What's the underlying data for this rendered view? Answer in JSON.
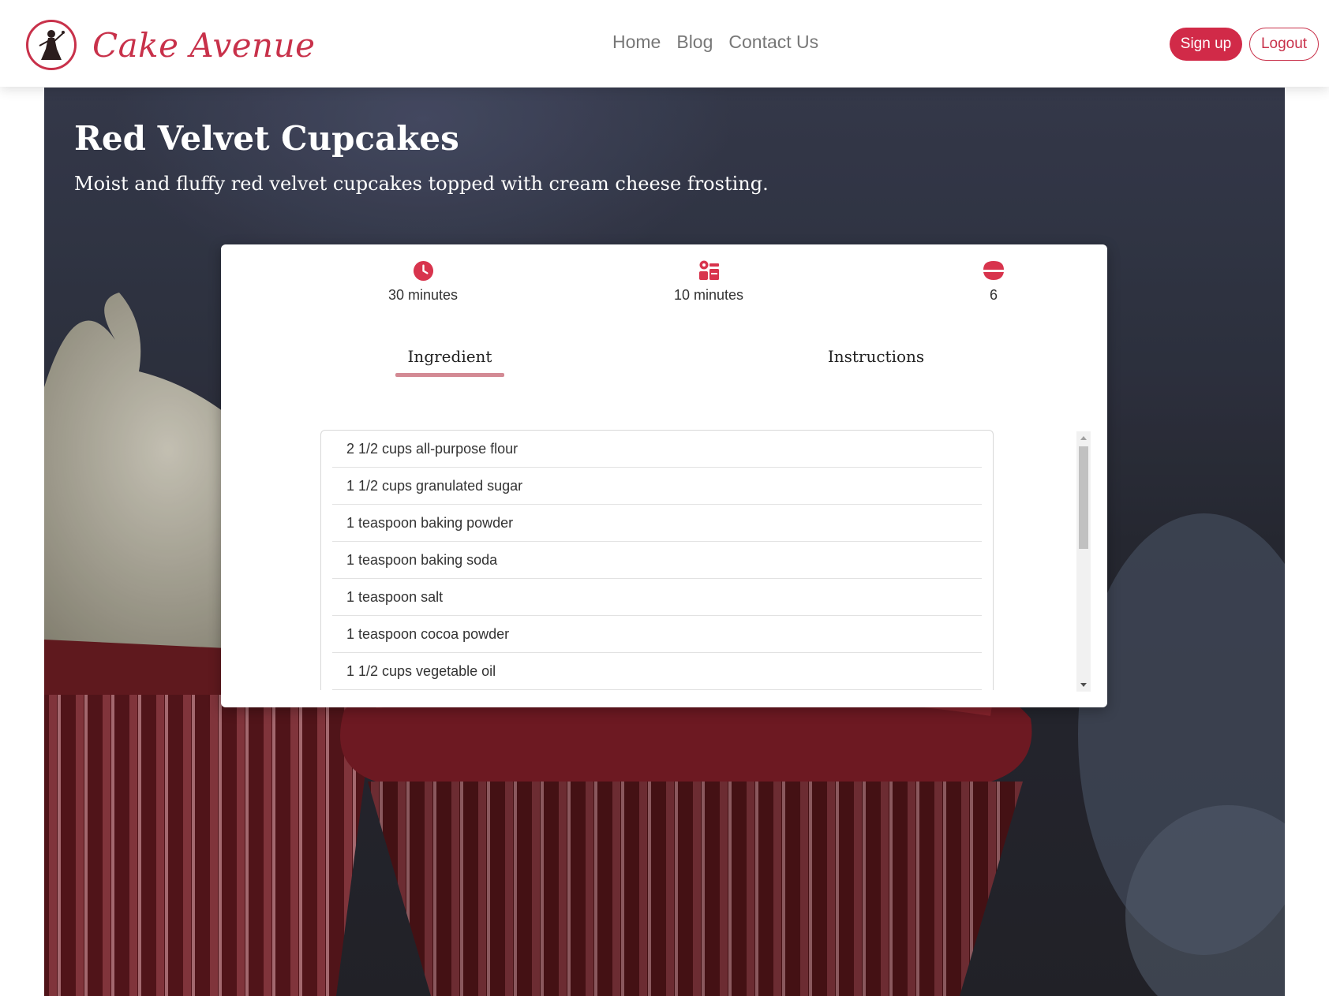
{
  "navbar": {
    "brand_name": "Cake Avenue",
    "logo_icon": "baker-silhouette-logo",
    "links": [
      "Home",
      "Blog",
      "Contact Us"
    ],
    "signup_label": "Sign up",
    "logout_label": "Logout"
  },
  "recipe": {
    "title": "Red Velvet Cupcakes",
    "description": "Moist and fluffy red velvet cupcakes topped with cream cheese frosting.",
    "stats": [
      {
        "icon": "clock-icon",
        "text": "30 minutes"
      },
      {
        "icon": "kitchen-tools-icon",
        "text": "10 minutes"
      },
      {
        "icon": "servings-bowl-icon",
        "text": "6"
      }
    ],
    "tabs": {
      "ingredient_label": "Ingredient",
      "instructions_label": "Instructions",
      "active": "Ingredient"
    },
    "ingredients": [
      "2 1/2 cups all-purpose flour",
      "1 1/2 cups granulated sugar",
      "1 teaspoon baking powder",
      "1 teaspoon baking soda",
      "1 teaspoon salt",
      "1 teaspoon cocoa powder",
      "1 1/2 cups vegetable oil"
    ]
  },
  "colors": {
    "accent": "#d12a48",
    "icon_red": "#d8344d",
    "hero_dark": "#2a2c36"
  }
}
